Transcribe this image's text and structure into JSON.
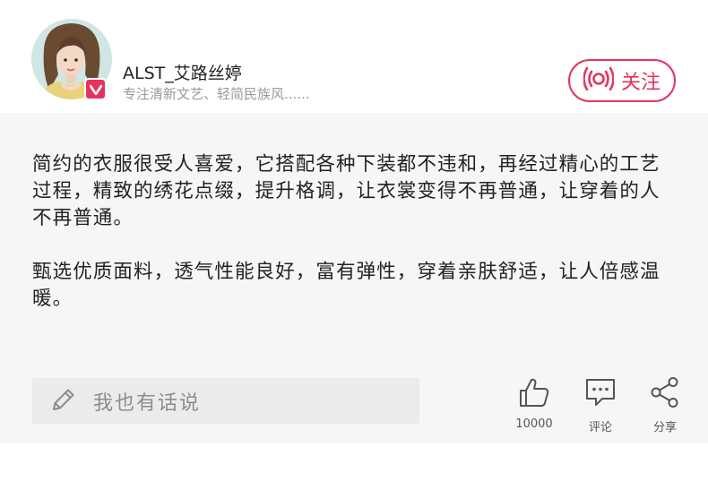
{
  "author": {
    "name": "ALST_艾路丝婷",
    "bio": "专注清新文艺、轻简民族风......",
    "verified_icon": "v-badge-icon",
    "accent_color": "#e8325e"
  },
  "follow_button": {
    "label": "关注",
    "icon": "broadcast-icon"
  },
  "article": {
    "paragraphs": [
      "简约的衣服很受人喜爱，它搭配各种下装都不违和，再经过精心的工艺过程，精致的绣花点缀，提升格调，让衣裳变得不再普通，让穿着的人不再普通。",
      "甄选优质面料，透气性能良好，富有弹性，穿着亲肤舒适，让人倍感温暖。"
    ]
  },
  "footer": {
    "comment_placeholder": "我也有话说",
    "comment_input_icon": "pencil-icon",
    "actions": [
      {
        "icon": "thumbs-up-icon",
        "label": "10000"
      },
      {
        "icon": "comment-bubble-icon",
        "label": "评论"
      },
      {
        "icon": "share-icon",
        "label": "分享"
      }
    ]
  }
}
